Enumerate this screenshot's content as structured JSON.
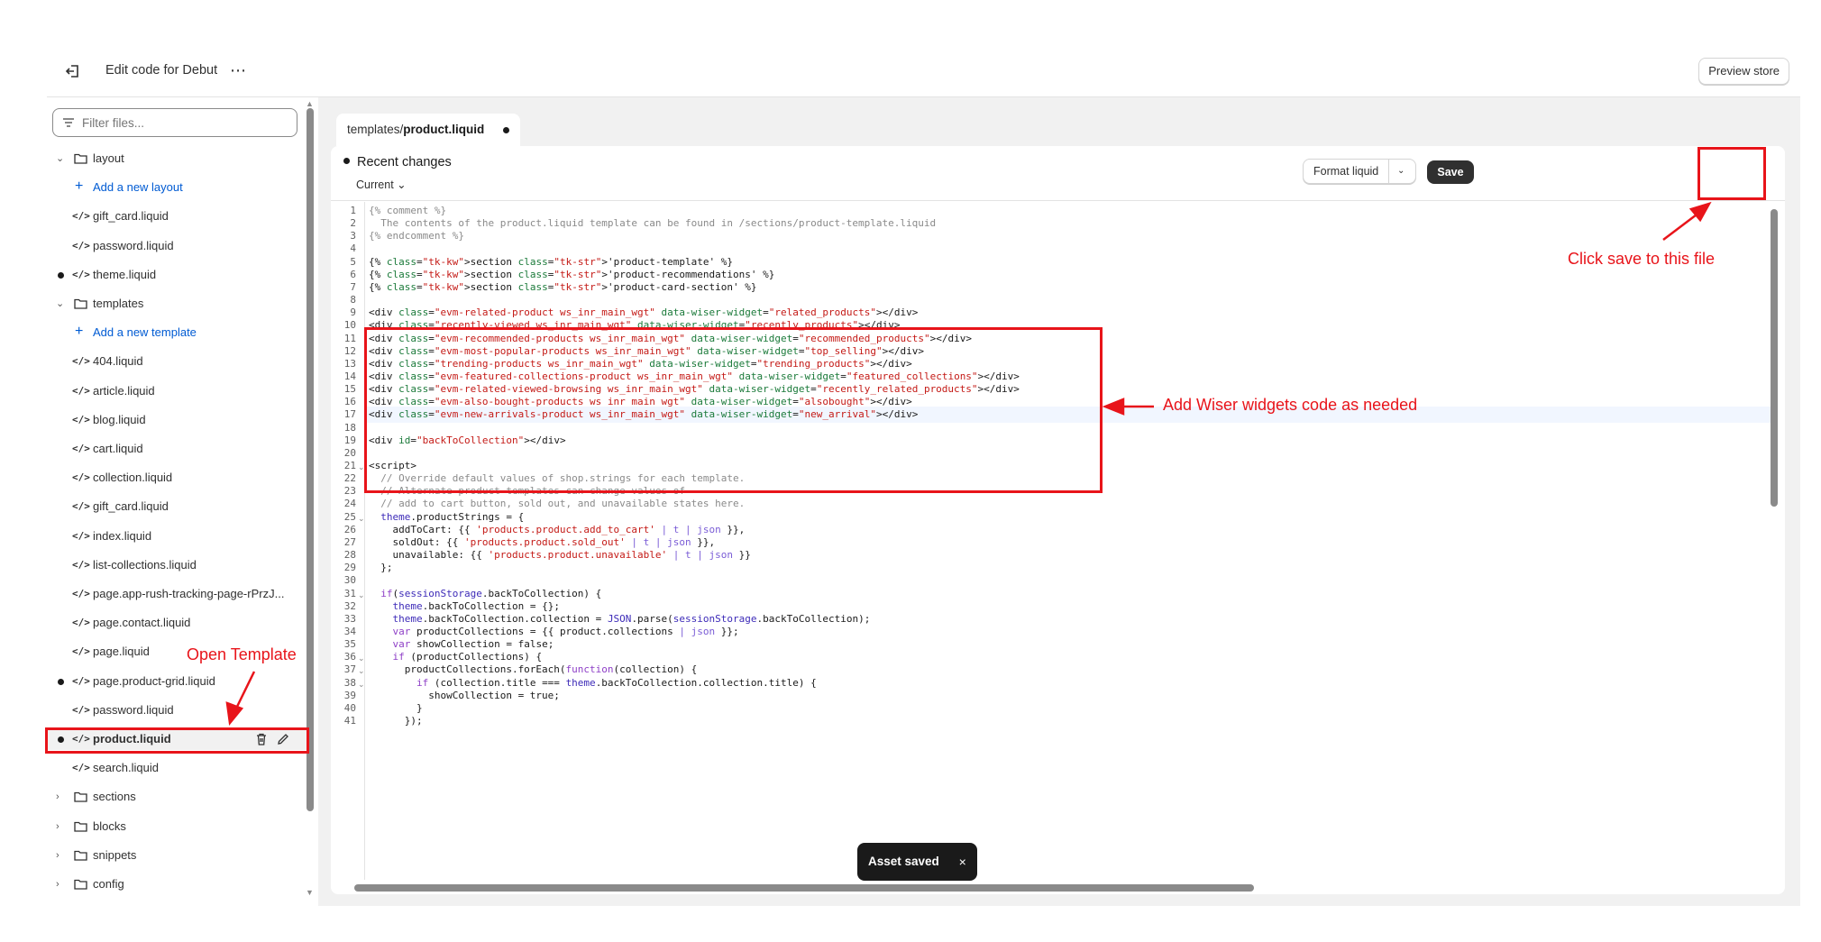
{
  "topbar": {
    "title": "Edit code for Debut",
    "more_label": "⋯",
    "preview_label": "Preview store"
  },
  "sidebar": {
    "filter_placeholder": "Filter files...",
    "items": [
      {
        "type": "folder",
        "label": "layout",
        "expanded": true
      },
      {
        "type": "add",
        "label": "Add a new layout"
      },
      {
        "type": "file",
        "label": "gift_card.liquid"
      },
      {
        "type": "file",
        "label": "password.liquid"
      },
      {
        "type": "file",
        "label": "theme.liquid",
        "modified": true
      },
      {
        "type": "folder",
        "label": "templates",
        "expanded": true
      },
      {
        "type": "add",
        "label": "Add a new template"
      },
      {
        "type": "file",
        "label": "404.liquid"
      },
      {
        "type": "file",
        "label": "article.liquid"
      },
      {
        "type": "file",
        "label": "blog.liquid"
      },
      {
        "type": "file",
        "label": "cart.liquid"
      },
      {
        "type": "file",
        "label": "collection.liquid"
      },
      {
        "type": "file",
        "label": "gift_card.liquid"
      },
      {
        "type": "file",
        "label": "index.liquid"
      },
      {
        "type": "file",
        "label": "list-collections.liquid"
      },
      {
        "type": "file",
        "label": "page.app-rush-tracking-page-rPrzJ..."
      },
      {
        "type": "file",
        "label": "page.contact.liquid"
      },
      {
        "type": "file",
        "label": "page.liquid"
      },
      {
        "type": "file",
        "label": "page.product-grid.liquid",
        "modified": true
      },
      {
        "type": "file",
        "label": "password.liquid"
      },
      {
        "type": "file",
        "label": "product.liquid",
        "modified": true,
        "selected": true
      },
      {
        "type": "file",
        "label": "search.liquid"
      },
      {
        "type": "folder",
        "label": "sections",
        "expanded": false
      },
      {
        "type": "folder",
        "label": "blocks",
        "expanded": false
      },
      {
        "type": "folder",
        "label": "snippets",
        "expanded": false
      },
      {
        "type": "folder",
        "label": "config",
        "expanded": false
      }
    ]
  },
  "editor": {
    "tab_prefix": "templates/",
    "tab_file": "product.liquid",
    "recent_label": "Recent changes",
    "current_label": "Current",
    "format_label": "Format liquid",
    "save_label": "Save",
    "highlighted_line": 17,
    "lines": [
      "{% comment %}",
      "  The contents of the product.liquid template can be found in /sections/product-template.liquid",
      "{% endcomment %}",
      "",
      "{% section 'product-template' %}",
      "{% section 'product-recommendations' %}",
      "{% section 'product-card-section' %}",
      "",
      "<div class=\"evm-related-product ws_inr_main_wgt\" data-wiser-widget=\"related_products\"></div>",
      "<div class=\"recently-viewed ws_inr_main_wgt\" data-wiser-widget=\"recently_products\"></div>",
      "<div class=\"evm-recommended-products ws_inr_main_wgt\" data-wiser-widget=\"recommended_products\"></div>",
      "<div class=\"evm-most-popular-products ws_inr_main_wgt\" data-wiser-widget=\"top_selling\"></div>",
      "<div class=\"trending-products ws_inr_main_wgt\" data-wiser-widget=\"trending_products\"></div>",
      "<div class=\"evm-featured-collections-product ws_inr_main_wgt\" data-wiser-widget=\"featured_collections\"></div>",
      "<div class=\"evm-related-viewed-browsing ws_inr_main_wgt\" data-wiser-widget=\"recently_related_products\"></div>",
      "<div class=\"evm-also-bought-products ws_inr_main_wgt\" data-wiser-widget=\"alsobought\"></div>",
      "<div class=\"evm-new-arrivals-product ws_inr_main_wgt\" data-wiser-widget=\"new_arrival\"></div>",
      "",
      "<div id=\"backToCollection\"></div>",
      "",
      "<script>",
      "  // Override default values of shop.strings for each template.",
      "  // Alternate product templates can change values of",
      "  // add to cart button, sold out, and unavailable states here.",
      "  theme.productStrings = {",
      "    addToCart: {{ 'products.product.add_to_cart' | t | json }},",
      "    soldOut: {{ 'products.product.sold_out' | t | json }},",
      "    unavailable: {{ 'products.product.unavailable' | t | json }}",
      "  };",
      "",
      "  if(sessionStorage.backToCollection) {",
      "    theme.backToCollection = {};",
      "    theme.backToCollection.collection = JSON.parse(sessionStorage.backToCollection);",
      "    var productCollections = {{ product.collections | json }};",
      "    var showCollection = false;",
      "    if (productCollections) {",
      "      productCollections.forEach(function(collection) {",
      "        if (collection.title === theme.backToCollection.collection.title) {",
      "          showCollection = true;",
      "        }",
      "      });"
    ],
    "fold_lines": [
      21,
      25,
      31,
      36,
      37,
      38
    ]
  },
  "toast": {
    "label": "Asset saved",
    "close": "×"
  },
  "annotations": {
    "save_note": "Click save to this file",
    "widgets_note": "Add Wiser widgets code as needed",
    "template_note": "Open Template",
    "color": "#e8141a"
  }
}
